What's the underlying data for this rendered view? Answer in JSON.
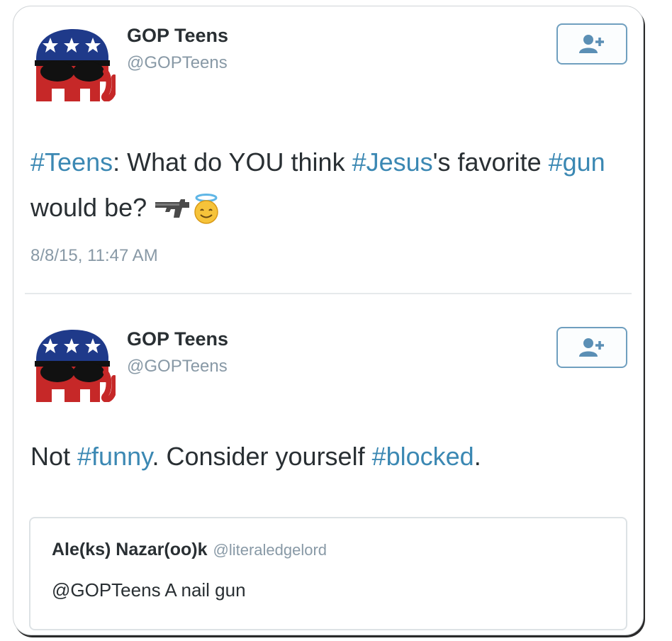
{
  "tweets": [
    {
      "author": {
        "name": "GOP Teens",
        "handle": "@GOPTeens"
      },
      "text_parts": [
        {
          "t": "#Teens",
          "hashtag": true
        },
        {
          "t": ": What do YOU think ",
          "hashtag": false
        },
        {
          "t": "#Jesus",
          "hashtag": true
        },
        {
          "t": "'s favorite ",
          "hashtag": false
        },
        {
          "t": "#gun",
          "hashtag": true
        },
        {
          "t": " would be?",
          "hashtag": false
        }
      ],
      "emojis": [
        "pistol-emoji",
        "smiling-face-with-halo-emoji"
      ],
      "timestamp": "8/8/15, 11:47 AM"
    },
    {
      "author": {
        "name": "GOP Teens",
        "handle": "@GOPTeens"
      },
      "text_parts": [
        {
          "t": "Not ",
          "hashtag": false
        },
        {
          "t": "#funny",
          "hashtag": true
        },
        {
          "t": ". Consider yourself ",
          "hashtag": false
        },
        {
          "t": "#blocked",
          "hashtag": true
        },
        {
          "t": ".",
          "hashtag": false
        }
      ],
      "quoted": {
        "name": "Ale(ks) Nazar(oo)k",
        "handle": "@literaledgelord",
        "text": "@GOPTeens A nail gun"
      }
    }
  ],
  "icons": {
    "avatar": "republican-elephant-logo",
    "follow": "add-user-icon"
  },
  "colors": {
    "hashtag": "#3b88b3",
    "muted": "#8899a6",
    "text": "#292f33",
    "follow_border": "#6f9fbf"
  }
}
